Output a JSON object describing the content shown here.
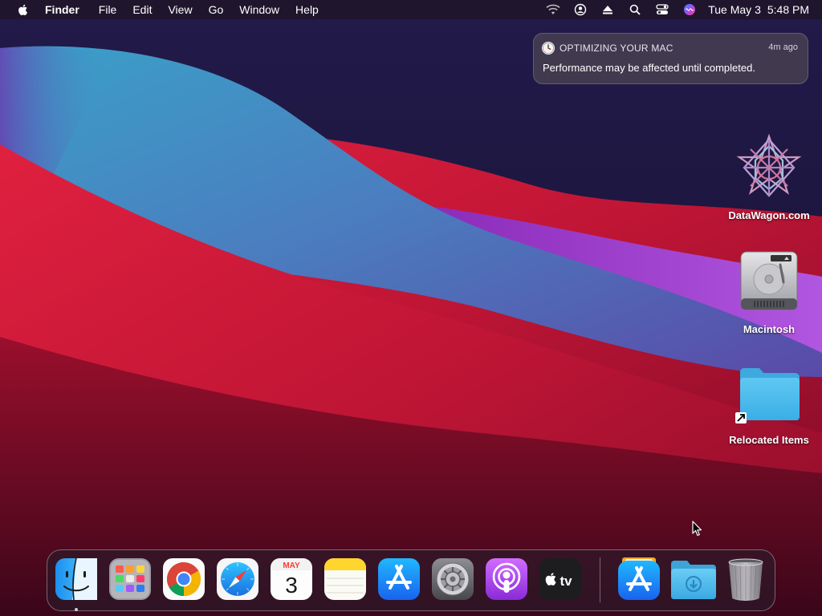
{
  "menubar": {
    "app_name": "Finder",
    "menus": [
      "File",
      "Edit",
      "View",
      "Go",
      "Window",
      "Help"
    ],
    "status_icons": [
      "wifi-icon",
      "user-icon",
      "eject-icon",
      "search-icon",
      "control-center-icon",
      "siri-icon"
    ],
    "date": "Tue May 3",
    "time": "5:48 PM"
  },
  "notification": {
    "icon": "clock-icon",
    "title": "OPTIMIZING YOUR MAC",
    "time": "4m ago",
    "body": "Performance may be affected until completed."
  },
  "desktop_icons": [
    {
      "name": "datawagon-icon",
      "label": "DataWagon.com"
    },
    {
      "name": "hard-drive-icon",
      "label": "Macintosh"
    },
    {
      "name": "folder-alias-icon",
      "label": "Relocated Items"
    }
  ],
  "dock": {
    "apps": [
      {
        "name": "finder-icon",
        "running": true
      },
      {
        "name": "launchpad-icon",
        "running": false
      },
      {
        "name": "chrome-icon",
        "running": false
      },
      {
        "name": "safari-icon",
        "running": false
      },
      {
        "name": "calendar-icon",
        "running": false,
        "month": "MAY",
        "day": "3"
      },
      {
        "name": "notes-icon",
        "running": false
      },
      {
        "name": "app-store-icon",
        "running": false
      },
      {
        "name": "system-preferences-icon",
        "running": false
      },
      {
        "name": "podcasts-icon",
        "running": false
      },
      {
        "name": "apple-tv-icon",
        "running": false,
        "label": "tv"
      }
    ],
    "others": [
      {
        "name": "app-store-installer-icon"
      },
      {
        "name": "downloads-folder-icon"
      },
      {
        "name": "trash-icon"
      }
    ]
  },
  "colors": {
    "wallpaper_dark": "#1a1238",
    "wallpaper_red": "#c21a3c",
    "wallpaper_blue": "#3c8fc0",
    "wallpaper_purple": "#9a4bd0",
    "accent_blue": "#1e7cf0"
  }
}
